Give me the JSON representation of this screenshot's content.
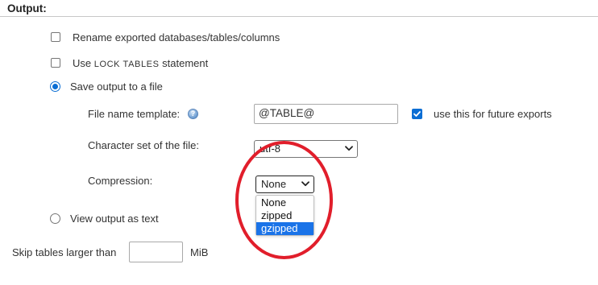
{
  "section": {
    "title": "Output:"
  },
  "options": {
    "rename": {
      "label": "Rename exported databases/tables/columns",
      "checked": false
    },
    "lock_tables": {
      "label_prefix": "Use",
      "label_keyword": "LOCK TABLES",
      "label_suffix": "statement",
      "checked": false
    },
    "save_to_file": {
      "label": "Save output to a file",
      "selected": true
    },
    "view_as_text": {
      "label": "View output as text",
      "selected": false
    }
  },
  "file_settings": {
    "template_label": "File name template:",
    "template_value": "@TABLE@",
    "future_exports_label": "use this for future exports",
    "future_exports_checked": true,
    "charset_label": "Character set of the file:",
    "charset_value": "utf-8",
    "compression_label": "Compression:",
    "compression_value": "None",
    "compression_options": [
      "None",
      "zipped",
      "gzipped"
    ],
    "compression_highlighted": "gzipped"
  },
  "skip_tables": {
    "label": "Skip tables larger than",
    "value": "",
    "unit": "MiB"
  },
  "icons": {
    "help": "help-icon",
    "chevron": "chevron-down-icon"
  },
  "colors": {
    "accent": "#0b6ed4",
    "highlight": "#1a73e8",
    "annotation": "#e11e2b"
  }
}
